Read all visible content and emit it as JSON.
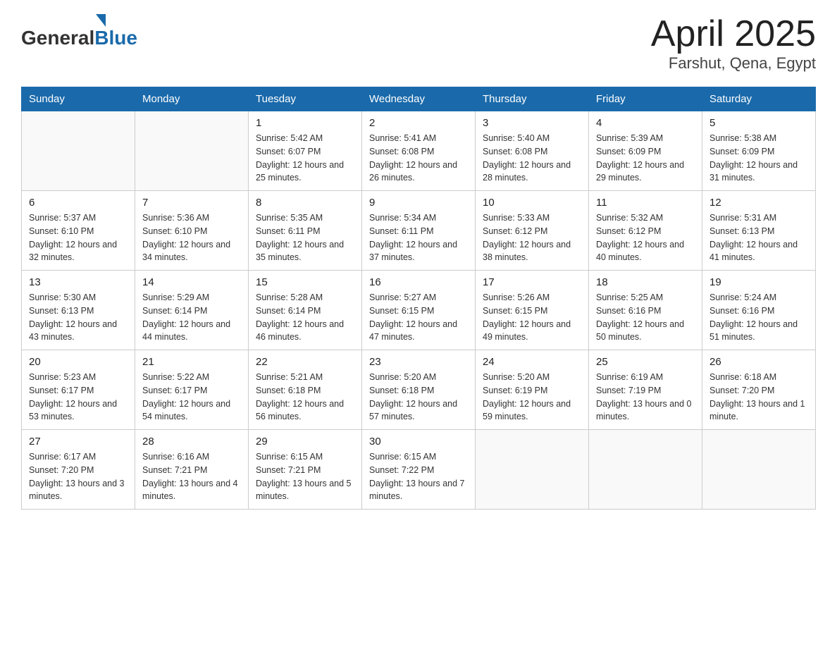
{
  "logo": {
    "general_text": "General",
    "blue_text": "Blue"
  },
  "title": "April 2025",
  "subtitle": "Farshut, Qena, Egypt",
  "days_of_week": [
    "Sunday",
    "Monday",
    "Tuesday",
    "Wednesday",
    "Thursday",
    "Friday",
    "Saturday"
  ],
  "weeks": [
    [
      {
        "day": "",
        "sunrise": "",
        "sunset": "",
        "daylight": ""
      },
      {
        "day": "",
        "sunrise": "",
        "sunset": "",
        "daylight": ""
      },
      {
        "day": "1",
        "sunrise": "Sunrise: 5:42 AM",
        "sunset": "Sunset: 6:07 PM",
        "daylight": "Daylight: 12 hours and 25 minutes."
      },
      {
        "day": "2",
        "sunrise": "Sunrise: 5:41 AM",
        "sunset": "Sunset: 6:08 PM",
        "daylight": "Daylight: 12 hours and 26 minutes."
      },
      {
        "day": "3",
        "sunrise": "Sunrise: 5:40 AM",
        "sunset": "Sunset: 6:08 PM",
        "daylight": "Daylight: 12 hours and 28 minutes."
      },
      {
        "day": "4",
        "sunrise": "Sunrise: 5:39 AM",
        "sunset": "Sunset: 6:09 PM",
        "daylight": "Daylight: 12 hours and 29 minutes."
      },
      {
        "day": "5",
        "sunrise": "Sunrise: 5:38 AM",
        "sunset": "Sunset: 6:09 PM",
        "daylight": "Daylight: 12 hours and 31 minutes."
      }
    ],
    [
      {
        "day": "6",
        "sunrise": "Sunrise: 5:37 AM",
        "sunset": "Sunset: 6:10 PM",
        "daylight": "Daylight: 12 hours and 32 minutes."
      },
      {
        "day": "7",
        "sunrise": "Sunrise: 5:36 AM",
        "sunset": "Sunset: 6:10 PM",
        "daylight": "Daylight: 12 hours and 34 minutes."
      },
      {
        "day": "8",
        "sunrise": "Sunrise: 5:35 AM",
        "sunset": "Sunset: 6:11 PM",
        "daylight": "Daylight: 12 hours and 35 minutes."
      },
      {
        "day": "9",
        "sunrise": "Sunrise: 5:34 AM",
        "sunset": "Sunset: 6:11 PM",
        "daylight": "Daylight: 12 hours and 37 minutes."
      },
      {
        "day": "10",
        "sunrise": "Sunrise: 5:33 AM",
        "sunset": "Sunset: 6:12 PM",
        "daylight": "Daylight: 12 hours and 38 minutes."
      },
      {
        "day": "11",
        "sunrise": "Sunrise: 5:32 AM",
        "sunset": "Sunset: 6:12 PM",
        "daylight": "Daylight: 12 hours and 40 minutes."
      },
      {
        "day": "12",
        "sunrise": "Sunrise: 5:31 AM",
        "sunset": "Sunset: 6:13 PM",
        "daylight": "Daylight: 12 hours and 41 minutes."
      }
    ],
    [
      {
        "day": "13",
        "sunrise": "Sunrise: 5:30 AM",
        "sunset": "Sunset: 6:13 PM",
        "daylight": "Daylight: 12 hours and 43 minutes."
      },
      {
        "day": "14",
        "sunrise": "Sunrise: 5:29 AM",
        "sunset": "Sunset: 6:14 PM",
        "daylight": "Daylight: 12 hours and 44 minutes."
      },
      {
        "day": "15",
        "sunrise": "Sunrise: 5:28 AM",
        "sunset": "Sunset: 6:14 PM",
        "daylight": "Daylight: 12 hours and 46 minutes."
      },
      {
        "day": "16",
        "sunrise": "Sunrise: 5:27 AM",
        "sunset": "Sunset: 6:15 PM",
        "daylight": "Daylight: 12 hours and 47 minutes."
      },
      {
        "day": "17",
        "sunrise": "Sunrise: 5:26 AM",
        "sunset": "Sunset: 6:15 PM",
        "daylight": "Daylight: 12 hours and 49 minutes."
      },
      {
        "day": "18",
        "sunrise": "Sunrise: 5:25 AM",
        "sunset": "Sunset: 6:16 PM",
        "daylight": "Daylight: 12 hours and 50 minutes."
      },
      {
        "day": "19",
        "sunrise": "Sunrise: 5:24 AM",
        "sunset": "Sunset: 6:16 PM",
        "daylight": "Daylight: 12 hours and 51 minutes."
      }
    ],
    [
      {
        "day": "20",
        "sunrise": "Sunrise: 5:23 AM",
        "sunset": "Sunset: 6:17 PM",
        "daylight": "Daylight: 12 hours and 53 minutes."
      },
      {
        "day": "21",
        "sunrise": "Sunrise: 5:22 AM",
        "sunset": "Sunset: 6:17 PM",
        "daylight": "Daylight: 12 hours and 54 minutes."
      },
      {
        "day": "22",
        "sunrise": "Sunrise: 5:21 AM",
        "sunset": "Sunset: 6:18 PM",
        "daylight": "Daylight: 12 hours and 56 minutes."
      },
      {
        "day": "23",
        "sunrise": "Sunrise: 5:20 AM",
        "sunset": "Sunset: 6:18 PM",
        "daylight": "Daylight: 12 hours and 57 minutes."
      },
      {
        "day": "24",
        "sunrise": "Sunrise: 5:20 AM",
        "sunset": "Sunset: 6:19 PM",
        "daylight": "Daylight: 12 hours and 59 minutes."
      },
      {
        "day": "25",
        "sunrise": "Sunrise: 6:19 AM",
        "sunset": "Sunset: 7:19 PM",
        "daylight": "Daylight: 13 hours and 0 minutes."
      },
      {
        "day": "26",
        "sunrise": "Sunrise: 6:18 AM",
        "sunset": "Sunset: 7:20 PM",
        "daylight": "Daylight: 13 hours and 1 minute."
      }
    ],
    [
      {
        "day": "27",
        "sunrise": "Sunrise: 6:17 AM",
        "sunset": "Sunset: 7:20 PM",
        "daylight": "Daylight: 13 hours and 3 minutes."
      },
      {
        "day": "28",
        "sunrise": "Sunrise: 6:16 AM",
        "sunset": "Sunset: 7:21 PM",
        "daylight": "Daylight: 13 hours and 4 minutes."
      },
      {
        "day": "29",
        "sunrise": "Sunrise: 6:15 AM",
        "sunset": "Sunset: 7:21 PM",
        "daylight": "Daylight: 13 hours and 5 minutes."
      },
      {
        "day": "30",
        "sunrise": "Sunrise: 6:15 AM",
        "sunset": "Sunset: 7:22 PM",
        "daylight": "Daylight: 13 hours and 7 minutes."
      },
      {
        "day": "",
        "sunrise": "",
        "sunset": "",
        "daylight": ""
      },
      {
        "day": "",
        "sunrise": "",
        "sunset": "",
        "daylight": ""
      },
      {
        "day": "",
        "sunrise": "",
        "sunset": "",
        "daylight": ""
      }
    ]
  ]
}
